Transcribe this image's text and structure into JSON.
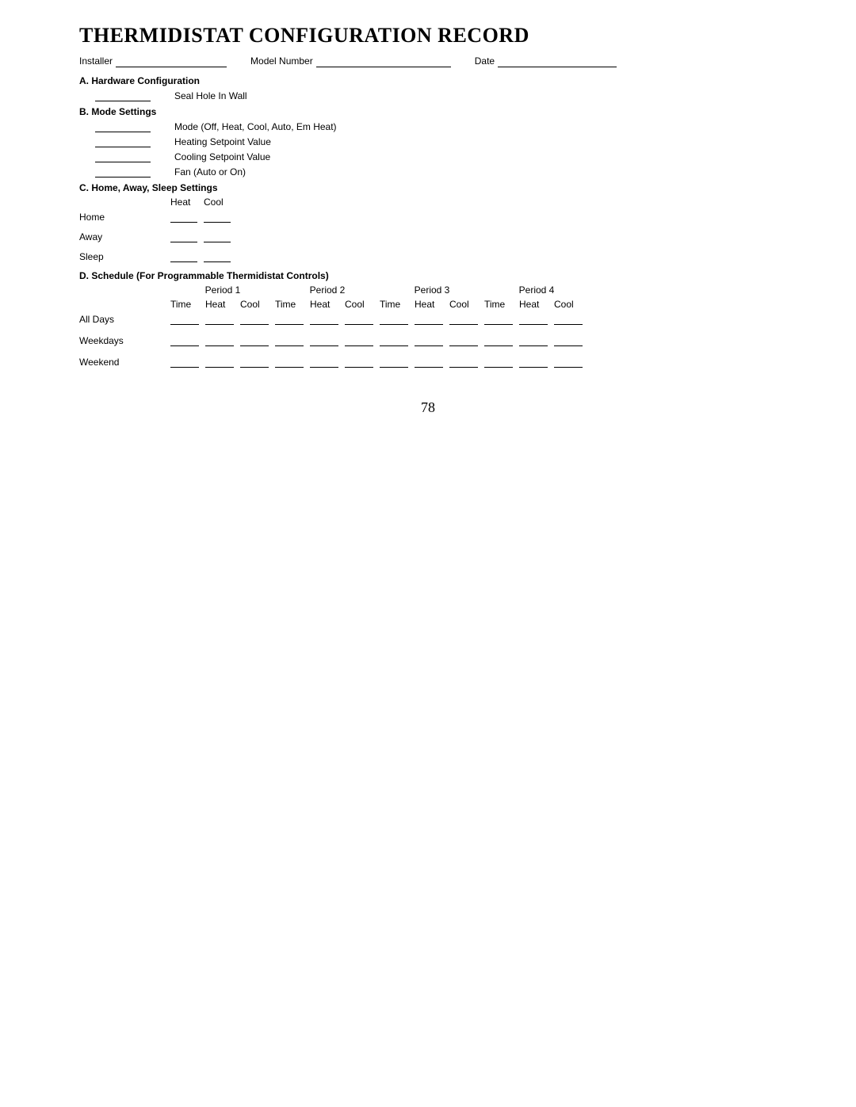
{
  "title": "THERMIDISTAT CONFIGURATION RECORD",
  "header": {
    "installer_label": "Installer",
    "model_label": "Model Number",
    "date_label": "Date"
  },
  "sectionA": {
    "title": "A. Hardware Configuration",
    "items": [
      "Seal Hole In Wall"
    ]
  },
  "sectionB": {
    "title": "B. Mode Settings",
    "items": [
      "Mode (Off, Heat, Cool, Auto, Em Heat)",
      "Heating Setpoint Value",
      "Cooling Setpoint Value",
      "Fan (Auto or On)"
    ]
  },
  "sectionC": {
    "title": "C. Home, Away, Sleep Settings",
    "cols": [
      "Heat",
      "Cool"
    ],
    "rows": [
      "Home",
      "Away",
      "Sleep"
    ]
  },
  "sectionD": {
    "title": "D. Schedule (For Programmable Thermidistat Controls)",
    "periods": [
      "Period 1",
      "Period 2",
      "Period 3",
      "Period 4"
    ],
    "subcols": [
      "Time",
      "Heat",
      "Cool"
    ],
    "rows": [
      "All Days",
      "Weekdays",
      "Weekend"
    ]
  },
  "page_number": "78"
}
